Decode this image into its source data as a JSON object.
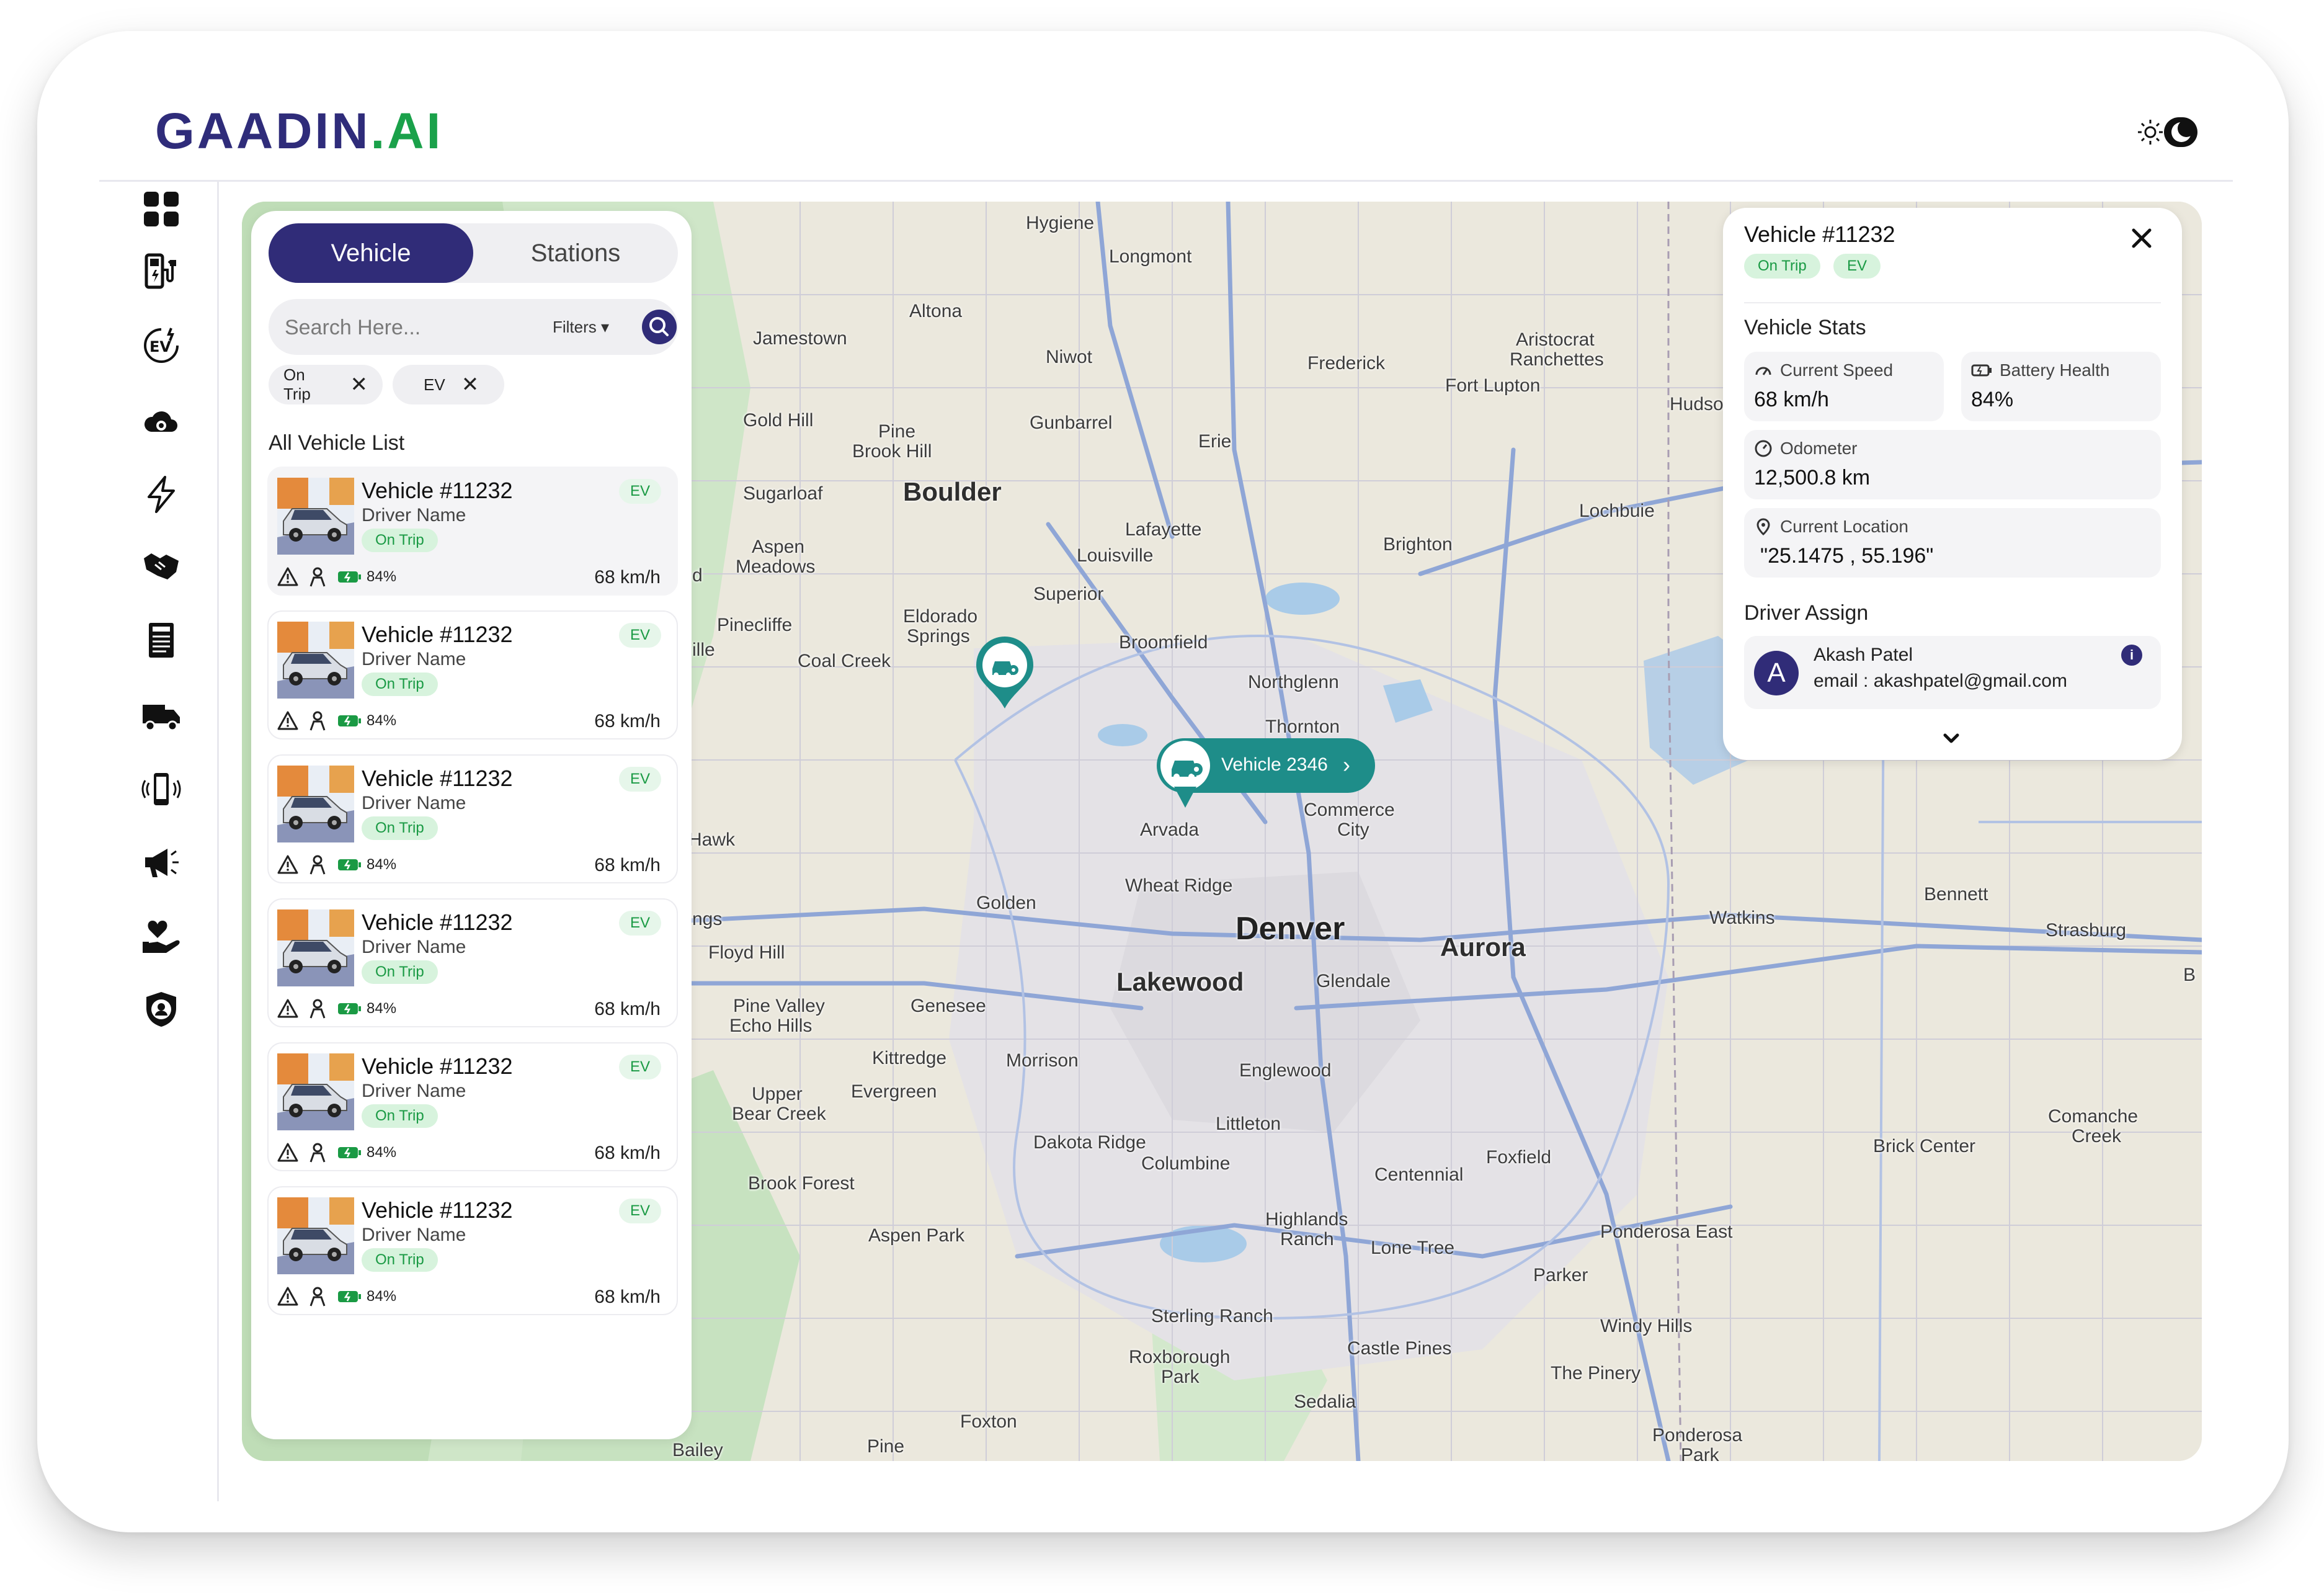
{
  "app": {
    "logo_main": "GAADIN",
    "logo_suffix": ".AI"
  },
  "sidebar": {
    "items": [
      {
        "icon": "dashboard-grid-icon"
      },
      {
        "icon": "ev-station-icon"
      },
      {
        "icon": "ev-badge-icon"
      },
      {
        "icon": "cloud-settings-icon"
      },
      {
        "icon": "lightning-icon"
      },
      {
        "icon": "handshake-icon"
      },
      {
        "icon": "report-icon"
      },
      {
        "icon": "truck-icon"
      },
      {
        "icon": "mobile-vibrate-icon"
      },
      {
        "icon": "megaphone-icon"
      },
      {
        "icon": "hand-heart-icon"
      },
      {
        "icon": "shield-user-icon"
      }
    ]
  },
  "left_panel": {
    "tabs": {
      "vehicle": "Vehicle",
      "stations": "Stations"
    },
    "search_placeholder": "Search Here...",
    "filters_label": "Filters",
    "chips": [
      {
        "label": "On Trip"
      },
      {
        "label": "EV"
      }
    ],
    "list_title": "All Vehicle List",
    "vehicles": [
      {
        "name": "Vehicle #11232",
        "driver": "Driver Name",
        "status": "On Trip",
        "type": "EV",
        "battery": "84%",
        "speed": "68 km/h"
      },
      {
        "name": "Vehicle #11232",
        "driver": "Driver Name",
        "status": "On Trip",
        "type": "EV",
        "battery": "84%",
        "speed": "68 km/h"
      },
      {
        "name": "Vehicle #11232",
        "driver": "Driver Name",
        "status": "On Trip",
        "type": "EV",
        "battery": "84%",
        "speed": "68 km/h"
      },
      {
        "name": "Vehicle #11232",
        "driver": "Driver Name",
        "status": "On Trip",
        "type": "EV",
        "battery": "84%",
        "speed": "68 km/h"
      },
      {
        "name": "Vehicle #11232",
        "driver": "Driver Name",
        "status": "On Trip",
        "type": "EV",
        "battery": "84%",
        "speed": "68 km/h"
      },
      {
        "name": "Vehicle #11232",
        "driver": "Driver Name",
        "status": "On Trip",
        "type": "EV",
        "battery": "84%",
        "speed": "68 km/h"
      }
    ]
  },
  "map": {
    "vehicle_pill": "Vehicle 2346",
    "labels": {
      "denver": "Denver",
      "aurora": "Aurora",
      "lakewood": "Lakewood",
      "boulder": "Boulder",
      "hygiene": "Hygiene",
      "longmont": "Longmont",
      "altona": "Altona",
      "jamestown": "Jamestown",
      "niwot": "Niwot",
      "frederick": "Frederick",
      "aristocrat": "Aristocrat",
      "ranchettes": "Ranchettes",
      "fort_lupton": "Fort Lupton",
      "hudson": "Hudso",
      "gold_hill": "Gold Hill",
      "pine": "Pine",
      "brook_hill": "Brook Hill",
      "gunbarrel": "Gunbarrel",
      "erie": "Erie",
      "sugarloaf": "Sugarloaf",
      "lochbuie": "Lochbuie",
      "lafayette": "Lafayette",
      "louisville": "Louisville",
      "aspen": "Aspen",
      "meadows": "Meadows",
      "brighton": "Brighton",
      "superior": "Superior",
      "pinecliffe": "Pinecliffe",
      "eldorado": "Eldorado",
      "springs": "Springs",
      "coal_creek": "Coal Creek",
      "broomfield": "Broomfield",
      "northglenn": "Northglenn",
      "thornton": "Thornton",
      "commerce": "Commerce",
      "city": "City",
      "arvada": "Arvada",
      "hawk": "Hawk",
      "golden": "Golden",
      "wheat_ridge": "Wheat Ridge",
      "bennett": "Bennett",
      "watkins": "Watkins",
      "strasburg": "Strasburg",
      "floyd_hill": "Floyd Hill",
      "glendale": "Glendale",
      "pine_valley": "Pine Valley",
      "echo_hills": "Echo Hills",
      "genesee": "Genesee",
      "kittredge": "Kittredge",
      "morrison": "Morrison",
      "englewood": "Englewood",
      "evergreen": "Evergreen",
      "upper": "Upper",
      "bear_creek": "Bear Creek",
      "littleton": "Littleton",
      "dakota_ridge": "Dakota Ridge",
      "columbine": "Columbine",
      "foxfield": "Foxfield",
      "comanche": "Comanche",
      "creek": "Creek",
      "brick_center": "Brick Center",
      "centennial": "Centennial",
      "brook_forest": "Brook Forest",
      "highlands": "Highlands",
      "ranch": "Ranch",
      "ponderosa_east": "Ponderosa East",
      "aspen_park": "Aspen Park",
      "lone_tree": "Lone Tree",
      "parker": "Parker",
      "sterling_ranch": "Sterling Ranch",
      "windy_hills": "Windy Hills",
      "castle_pines": "Castle Pines",
      "roxborough": "Roxborough",
      "park": "Park",
      "the_pinery": "The Pinery",
      "sedalia": "Sedalia",
      "foxton": "Foxton",
      "ponderosa": "Ponderosa",
      "park2": "Park",
      "bailey": "Bailey",
      "pine2": "Pine",
      "ille": "ille",
      "ngs": "ngs",
      "d": "d",
      "b": "B"
    }
  },
  "detail": {
    "title": "Vehicle #11232",
    "badges": [
      "On Trip",
      "EV"
    ],
    "stats_title": "Vehicle Stats",
    "stats": {
      "speed_label": "Current Speed",
      "speed_value": "68 km/h",
      "battery_label": "Battery Health",
      "battery_value": "84%",
      "odometer_label": "Odometer",
      "odometer_value": "12,500.8 km",
      "location_label": "Current Location",
      "location_value": "\"25.1475 , 55.196\""
    },
    "driver_title": "Driver Assign",
    "driver": {
      "initial": "A",
      "name": "Akash Patel",
      "email": "email : akashpatel@gmail.com"
    }
  },
  "colors": {
    "brand": "#302c78",
    "accent_green": "#1a9a44",
    "pill_teal": "#1e8d89"
  }
}
